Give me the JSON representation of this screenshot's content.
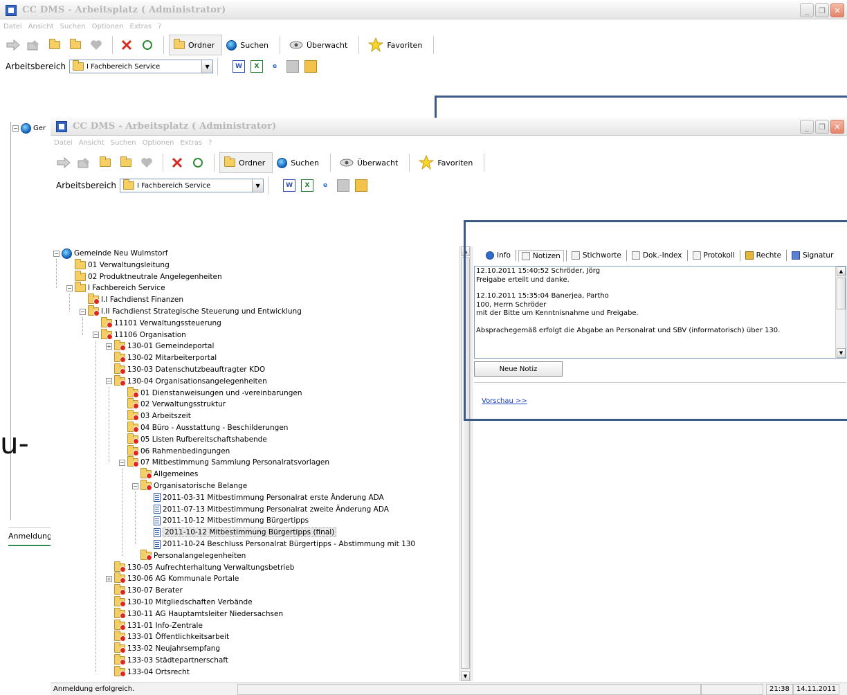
{
  "window": {
    "title": "CC DMS - Arbeitsplatz ( Administrator)"
  },
  "menu": [
    "Datei",
    "Ansicht",
    "Suchen",
    "Optionen",
    "Extras",
    "?"
  ],
  "toolbar": {
    "ordner_label": "Ordner",
    "suchen_label": "Suchen",
    "ueberwacht_label": "Überwacht",
    "favoriten_label": "Favoriten"
  },
  "workspace": {
    "label": "Arbeitsbereich",
    "selected": "I Fachbereich Service"
  },
  "back_window": {
    "tree_fragment": "Ger",
    "status": "Anmeldung"
  },
  "overlay_text": "u-",
  "tree": [
    {
      "label": "Gemeinde Neu Wulmstorf",
      "level": 0,
      "icon": "globe-icon",
      "expander": "-"
    },
    {
      "label": "01 Verwaltungsleitung",
      "level": 1,
      "icon": "folder-icon",
      "expander": ""
    },
    {
      "label": "02 Produktneutrale Angelegenheiten",
      "level": 1,
      "icon": "folder-icon",
      "expander": ""
    },
    {
      "label": "I Fachbereich Service",
      "level": 1,
      "icon": "folder-icon",
      "expander": "-"
    },
    {
      "label": "I.I Fachdienst Finanzen",
      "level": 2,
      "icon": "folder-red-icon",
      "expander": ""
    },
    {
      "label": "I.II Fachdienst Strategische Steuerung und Entwicklung",
      "level": 2,
      "icon": "folder-red-icon",
      "expander": "-"
    },
    {
      "label": "11101 Verwaltungssteuerung",
      "level": 3,
      "icon": "folder-red-icon",
      "expander": ""
    },
    {
      "label": "11106 Organisation",
      "level": 3,
      "icon": "folder-red-icon",
      "expander": "-"
    },
    {
      "label": "130-01 Gemeindeportal",
      "level": 4,
      "icon": "folder-red-icon",
      "expander": "+"
    },
    {
      "label": "130-02 Mitarbeiterportal",
      "level": 4,
      "icon": "folder-red-icon",
      "expander": ""
    },
    {
      "label": "130-03 Datenschutzbeauftragter KDO",
      "level": 4,
      "icon": "folder-red-icon",
      "expander": ""
    },
    {
      "label": "130-04 Organisationsangelegenheiten",
      "level": 4,
      "icon": "folder-red-icon",
      "expander": "-"
    },
    {
      "label": "01 Dienstanweisungen und -vereinbarungen",
      "level": 5,
      "icon": "folder-red-icon",
      "expander": ""
    },
    {
      "label": "02 Verwaltungsstruktur",
      "level": 5,
      "icon": "folder-red-icon",
      "expander": ""
    },
    {
      "label": "03 Arbeitszeit",
      "level": 5,
      "icon": "folder-red-icon",
      "expander": ""
    },
    {
      "label": "04 Büro - Ausstattung - Beschilderungen",
      "level": 5,
      "icon": "folder-red-icon",
      "expander": ""
    },
    {
      "label": "05 Listen Rufbereitschaftshabende",
      "level": 5,
      "icon": "folder-red-icon",
      "expander": ""
    },
    {
      "label": "06 Rahmenbedingungen",
      "level": 5,
      "icon": "folder-red-icon",
      "expander": ""
    },
    {
      "label": "07 Mitbestimmung Sammlung Personalratsvorlagen",
      "level": 5,
      "icon": "folder-red-icon",
      "expander": "-"
    },
    {
      "label": "Allgemeines",
      "level": 6,
      "icon": "folder-red-icon",
      "expander": ""
    },
    {
      "label": "Organisatorische Belange",
      "level": 6,
      "icon": "folder-red-icon",
      "expander": "-"
    },
    {
      "label": "2011-03-31 Mitbestimmung Personalrat erste Änderung ADA",
      "level": 7,
      "icon": "document-icon",
      "expander": ""
    },
    {
      "label": "2011-07-13 Mitbestimmung Personalrat zweite Änderung ADA",
      "level": 7,
      "icon": "document-icon",
      "expander": ""
    },
    {
      "label": "2011-10-12 Mitbestimmung Bürgertipps",
      "level": 7,
      "icon": "document-icon",
      "expander": ""
    },
    {
      "label": "2011-10-12 Mitbestimmung Bürgertipps (final)",
      "level": 7,
      "icon": "document-icon",
      "expander": "",
      "selected": true
    },
    {
      "label": "2011-10-24 Beschluss Personalrat Bürgertipps - Abstimmung mit 130",
      "level": 7,
      "icon": "document-icon",
      "expander": ""
    },
    {
      "label": "Personalangelegenheiten",
      "level": 6,
      "icon": "folder-red-icon",
      "expander": ""
    },
    {
      "label": "130-05 Aufrechterhaltung Verwaltungsbetrieb",
      "level": 4,
      "icon": "folder-red-icon",
      "expander": ""
    },
    {
      "label": "130-06 AG Kommunale Portale",
      "level": 4,
      "icon": "folder-red-icon",
      "expander": "+"
    },
    {
      "label": "130-07 Berater",
      "level": 4,
      "icon": "folder-red-icon",
      "expander": ""
    },
    {
      "label": "130-10 Mitgliedschaften Verbände",
      "level": 4,
      "icon": "folder-red-icon",
      "expander": ""
    },
    {
      "label": "130-11 AG Hauptamtsleiter Niedersachsen",
      "level": 4,
      "icon": "folder-red-icon",
      "expander": ""
    },
    {
      "label": "131-01 Info-Zentrale",
      "level": 4,
      "icon": "folder-red-icon",
      "expander": ""
    },
    {
      "label": "133-01 Öffentlichkeitsarbeit",
      "level": 4,
      "icon": "folder-red-icon",
      "expander": ""
    },
    {
      "label": "133-02 Neujahrsempfang",
      "level": 4,
      "icon": "folder-red-icon",
      "expander": ""
    },
    {
      "label": "133-03 Städtepartnerschaft",
      "level": 4,
      "icon": "folder-red-icon",
      "expander": ""
    },
    {
      "label": "133-04 Ortsrecht",
      "level": 4,
      "icon": "folder-red-icon",
      "expander": ""
    }
  ],
  "tabs": [
    {
      "label": "Info",
      "icon": "info-icon",
      "active": false
    },
    {
      "label": "Notizen",
      "icon": "notes-icon",
      "active": true
    },
    {
      "label": "Stichworte",
      "icon": "keywords-icon",
      "active": false
    },
    {
      "label": "Dok.-Index",
      "icon": "document-index-icon",
      "active": false
    },
    {
      "label": "Protokoll",
      "icon": "log-icon",
      "active": false
    },
    {
      "label": "Rechte",
      "icon": "lock-icon",
      "active": false
    },
    {
      "label": "Signatur",
      "icon": "signature-icon",
      "active": false
    }
  ],
  "notes": [
    {
      "header": "12.10.2011 15:40:52 Schröder, Jörg",
      "lines": [
        "Freigabe erteilt und danke."
      ]
    },
    {
      "header": "12.10.2011 15:35:04 Banerjea, Partho",
      "lines": [
        "100, Herrn Schröder",
        "mit der Bitte um Kenntnisnahme und Freigabe.",
        "",
        "Absprachegemäß erfolgt die Abgabe an Personalrat und SBV (informatorisch) über 130."
      ]
    }
  ],
  "notes_button": "Neue Notiz",
  "preview_link": "Vorschau >>",
  "status": {
    "message": "Anmeldung erfolgreich.",
    "time": "21:38",
    "date": "14.11.2011"
  }
}
